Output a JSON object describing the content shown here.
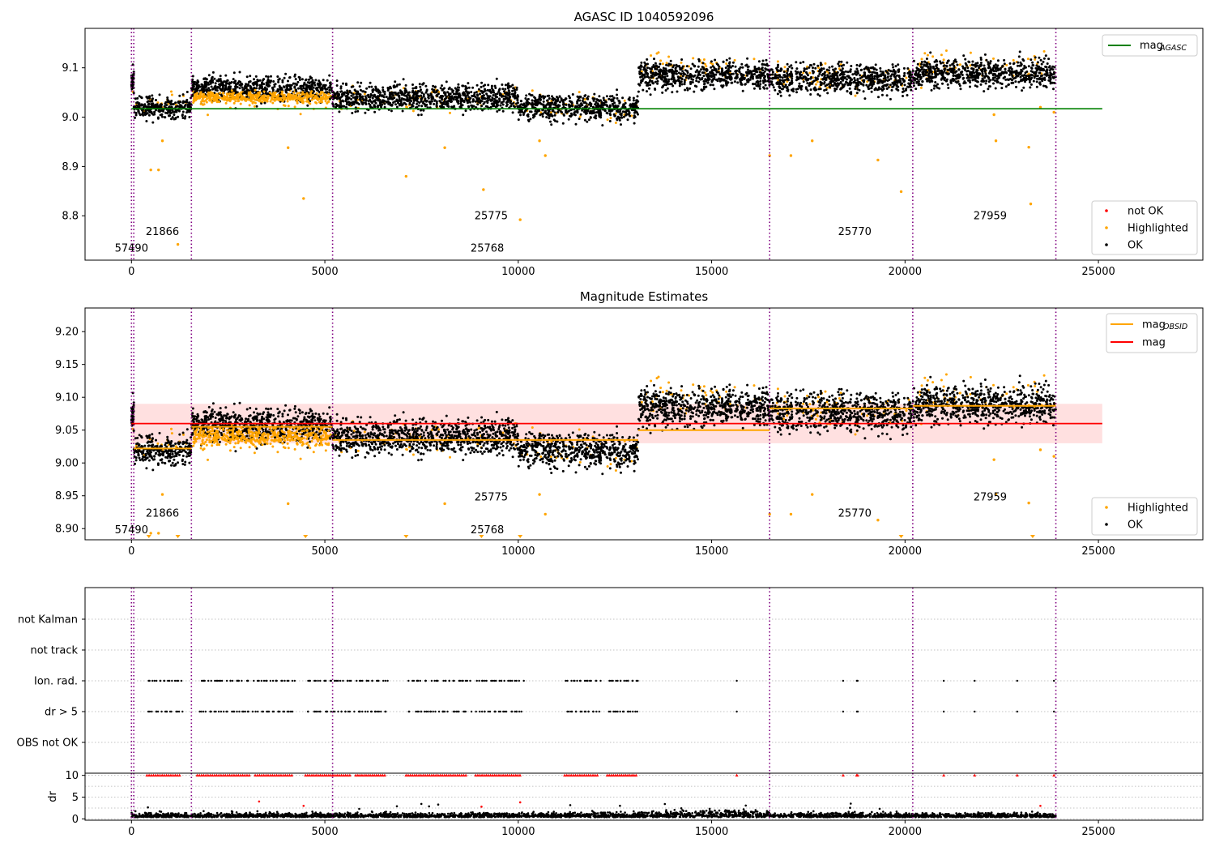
{
  "chart_data": [
    {
      "type": "scatter",
      "title": "AGASC ID 1040592096",
      "xlim": [
        -1200,
        27700
      ],
      "ylim": [
        8.71,
        9.18
      ],
      "xticks": [
        0,
        5000,
        10000,
        15000,
        20000,
        25000
      ],
      "yticks": [
        8.8,
        8.9,
        9.0,
        9.1
      ],
      "ytick_labels": [
        "8.8",
        "8.9",
        "9.0",
        "9.1"
      ],
      "vlines": [
        0,
        60,
        1550,
        5200,
        16500,
        20200,
        23900
      ],
      "hline": {
        "name": "magAGASC",
        "value": 9.017,
        "x": [
          0,
          25100
        ],
        "color": "#008000"
      },
      "legend_lines": [
        {
          "main": "mag",
          "sub": "AGASC",
          "color": "#008000"
        }
      ],
      "legend_points": [
        {
          "label": "not OK",
          "color": "#ff0000"
        },
        {
          "label": "Highlighted",
          "color": "#ffa500"
        },
        {
          "label": "OK",
          "color": "#000000"
        }
      ],
      "segments": [
        {
          "x0": 0,
          "x1": 60,
          "mean": 9.075,
          "spread": 0.012,
          "hl_mean": 9.07
        },
        {
          "x0": 60,
          "x1": 1550,
          "mean": 9.02,
          "spread": 0.011,
          "hl_mean": 9.03
        },
        {
          "x0": 1550,
          "x1": 5200,
          "mean": 9.058,
          "spread": 0.013,
          "hl_mean": 9.04
        },
        {
          "x0": 5200,
          "x1": 10000,
          "mean": 9.04,
          "spread": 0.013,
          "hl_mean": 9.04
        },
        {
          "x0": 10000,
          "x1": 13100,
          "mean": 9.02,
          "spread": 0.013,
          "hl_mean": 9.02
        },
        {
          "x0": 13100,
          "x1": 16500,
          "mean": 9.085,
          "spread": 0.014,
          "hl_mean": 9.1
        },
        {
          "x0": 16500,
          "x1": 20200,
          "mean": 9.078,
          "spread": 0.014,
          "hl_mean": 9.08
        },
        {
          "x0": 20200,
          "x1": 23900,
          "mean": 9.088,
          "spread": 0.014,
          "hl_mean": 9.1
        }
      ],
      "outliers": [
        {
          "x": 500,
          "y": 8.893
        },
        {
          "x": 700,
          "y": 8.893
        },
        {
          "x": 800,
          "y": 8.952
        },
        {
          "x": 1200,
          "y": 8.742
        },
        {
          "x": 4050,
          "y": 8.938
        },
        {
          "x": 4450,
          "y": 8.835
        },
        {
          "x": 7100,
          "y": 8.88
        },
        {
          "x": 8100,
          "y": 8.938
        },
        {
          "x": 9100,
          "y": 8.853
        },
        {
          "x": 10050,
          "y": 8.792
        },
        {
          "x": 10550,
          "y": 8.952
        },
        {
          "x": 10700,
          "y": 8.922
        },
        {
          "x": 16500,
          "y": 8.922
        },
        {
          "x": 17050,
          "y": 8.922
        },
        {
          "x": 17600,
          "y": 8.952
        },
        {
          "x": 19300,
          "y": 8.913
        },
        {
          "x": 19900,
          "y": 8.849
        },
        {
          "x": 22300,
          "y": 9.005
        },
        {
          "x": 22350,
          "y": 8.952
        },
        {
          "x": 23200,
          "y": 8.939
        },
        {
          "x": 23250,
          "y": 8.824
        },
        {
          "x": 23500,
          "y": 9.02
        },
        {
          "x": 23850,
          "y": 9.01
        }
      ],
      "obsid_labels": [
        {
          "text": "57490",
          "x": 0,
          "y": 8.727
        },
        {
          "text": "21866",
          "x": 800,
          "y": 8.761
        },
        {
          "text": "25775",
          "x": 9300,
          "y": 8.793
        },
        {
          "text": "25768",
          "x": 9200,
          "y": 8.727
        },
        {
          "text": "25770",
          "x": 18700,
          "y": 8.761
        },
        {
          "text": "27959",
          "x": 22200,
          "y": 8.793
        }
      ]
    },
    {
      "type": "scatter",
      "title": "Magnitude Estimates",
      "xlim": [
        -1200,
        27700
      ],
      "ylim": [
        8.883,
        9.236
      ],
      "xticks": [
        0,
        5000,
        10000,
        15000,
        20000,
        25000
      ],
      "yticks": [
        8.9,
        8.95,
        9.0,
        9.05,
        9.1,
        9.15,
        9.2
      ],
      "ytick_labels": [
        "8.90",
        "8.95",
        "9.00",
        "9.05",
        "9.10",
        "9.15",
        "9.20"
      ],
      "vlines": [
        0,
        60,
        1550,
        5200,
        16500,
        20200,
        23900
      ],
      "mag_band": {
        "value": 9.06,
        "low": 9.03,
        "high": 9.09,
        "x": [
          0,
          25100
        ],
        "color": "#ff0000"
      },
      "obsid_levels": [
        {
          "x0": 60,
          "x1": 1550,
          "value": 9.022
        },
        {
          "x0": 1550,
          "x1": 5200,
          "value": 9.055
        },
        {
          "x0": 5200,
          "x1": 13100,
          "value": 9.035
        },
        {
          "x0": 13100,
          "x1": 16500,
          "value": 9.05
        },
        {
          "x0": 16500,
          "x1": 20200,
          "value": 9.083
        },
        {
          "x0": 20200,
          "x1": 23900,
          "value": 9.087
        }
      ],
      "legend_lines": [
        {
          "main": "mag",
          "sub": "OBSID",
          "color": "#ffa500"
        },
        {
          "main": "mag",
          "sub": "",
          "color": "#ff0000"
        }
      ],
      "legend_points": [
        {
          "label": "Highlighted",
          "color": "#ffa500"
        },
        {
          "label": "OK",
          "color": "#000000"
        }
      ],
      "obsid_labels": [
        {
          "text": "57490",
          "x": 0,
          "y": 8.893
        },
        {
          "text": "21866",
          "x": 800,
          "y": 8.918
        },
        {
          "text": "25775",
          "x": 9300,
          "y": 8.943
        },
        {
          "text": "25768",
          "x": 9200,
          "y": 8.893
        },
        {
          "text": "25770",
          "x": 18700,
          "y": 8.918
        },
        {
          "text": "27959",
          "x": 22200,
          "y": 8.943
        }
      ],
      "clipped_markers": [
        450,
        1200,
        4500,
        7100,
        9050,
        10050,
        19900,
        23300
      ]
    },
    {
      "type": "scatter",
      "title": "",
      "xlim": [
        -1200,
        27700
      ],
      "categories": [
        "not Kalman",
        "not track",
        "Ion. rad.",
        "dr > 5",
        "OBS not OK"
      ],
      "flag_rows": {
        "Ion. rad.": [
          [
            400,
            1300
          ],
          [
            1700,
            3100
          ],
          [
            3200,
            4200
          ],
          [
            4500,
            5700
          ],
          [
            5800,
            6600
          ],
          [
            7100,
            8700
          ],
          [
            8900,
            10100
          ],
          [
            11200,
            12100
          ],
          [
            12300,
            13100
          ],
          [
            15650,
            15650
          ],
          [
            18400,
            18400
          ],
          [
            18750,
            18800
          ],
          [
            21000,
            21000
          ],
          [
            21800,
            21800
          ],
          [
            22900,
            22900
          ],
          [
            23850,
            23850
          ]
        ],
        "dr > 5": [
          [
            400,
            1300
          ],
          [
            1700,
            3100
          ],
          [
            3200,
            4200
          ],
          [
            4500,
            5700
          ],
          [
            5800,
            6600
          ],
          [
            7100,
            8700
          ],
          [
            8900,
            10100
          ],
          [
            11200,
            12100
          ],
          [
            12300,
            13100
          ],
          [
            15650,
            15650
          ],
          [
            18400,
            18400
          ],
          [
            18750,
            18800
          ],
          [
            21000,
            21000
          ],
          [
            21800,
            21800
          ],
          [
            22900,
            22900
          ],
          [
            23850,
            23850
          ]
        ]
      },
      "vlines": [
        0,
        60,
        1550,
        5200,
        16500,
        20200,
        23900
      ]
    },
    {
      "type": "scatter",
      "title": "",
      "xlim": [
        -1200,
        27700
      ],
      "ylim": [
        -0.3,
        10.5
      ],
      "ylabel": "dr",
      "xticks": [
        0,
        5000,
        10000,
        15000,
        20000,
        25000
      ],
      "yticks": [
        0,
        5,
        10
      ],
      "ytick_labels": [
        "0",
        "5",
        "10"
      ],
      "clip_value": 10,
      "clipped_ranges": [
        [
          400,
          1300
        ],
        [
          1700,
          3100
        ],
        [
          3200,
          4200
        ],
        [
          4500,
          5700
        ],
        [
          5800,
          6600
        ],
        [
          7100,
          8700
        ],
        [
          8900,
          10100
        ],
        [
          11200,
          12100
        ],
        [
          12300,
          13100
        ],
        [
          15650,
          15650
        ],
        [
          18400,
          18400
        ],
        [
          18750,
          18800
        ],
        [
          21000,
          21000
        ],
        [
          21800,
          21800
        ],
        [
          22900,
          22900
        ],
        [
          23850,
          23850
        ]
      ],
      "vlines": [
        0,
        60,
        1550,
        5200,
        16500,
        20200,
        23900
      ]
    }
  ]
}
